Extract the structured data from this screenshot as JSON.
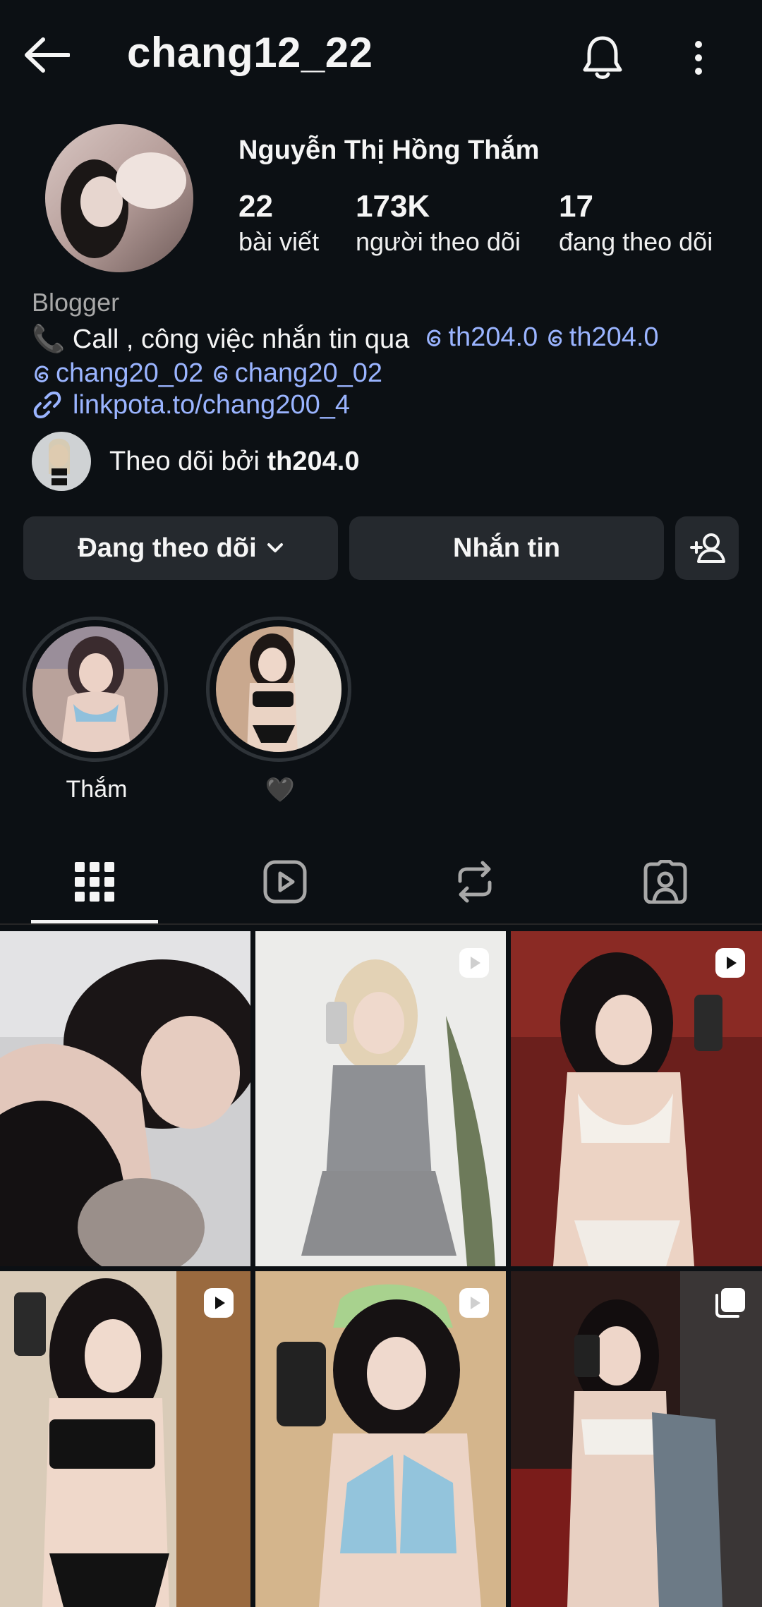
{
  "header": {
    "username": "chang12_22",
    "icons": [
      "back-arrow-icon",
      "bell-icon",
      "more-vertical-icon"
    ]
  },
  "profile": {
    "full_name": "Nguyễn Thị Hồng Thắm",
    "stats": [
      {
        "value": "22",
        "label": "bài viết"
      },
      {
        "value": "173K",
        "label": "người theo dõi"
      },
      {
        "value": "17",
        "label": "đang theo dõi"
      }
    ],
    "category": "Blogger",
    "bio_prefix": "📞 Call , công việc nhắn tin qua",
    "mentions": [
      "th204.0",
      "th204.0",
      "chang20_02",
      "chang20_02"
    ],
    "link": "linkpota.to/chang200_4",
    "followed_by_prefix": "Theo dõi bởi",
    "followed_by_user": "th204.0"
  },
  "actions": {
    "following_label": "Đang theo dõi",
    "message_label": "Nhắn tin"
  },
  "highlights": [
    {
      "label": "Thắm"
    },
    {
      "label": "🖤"
    }
  ],
  "tabs": [
    "grid-icon",
    "reels-icon",
    "reposts-icon",
    "tagged-icon"
  ],
  "grid": [
    {
      "badge": ""
    },
    {
      "badge": "reel-icon"
    },
    {
      "badge": "reel-icon"
    },
    {
      "badge": "reel-icon"
    },
    {
      "badge": "reel-icon"
    },
    {
      "badge": "carousel-icon"
    }
  ],
  "colors": {
    "background": "#0c1014",
    "button": "#25292e",
    "link": "#9ab4ff",
    "secondary_text": "#a8a8a8"
  }
}
